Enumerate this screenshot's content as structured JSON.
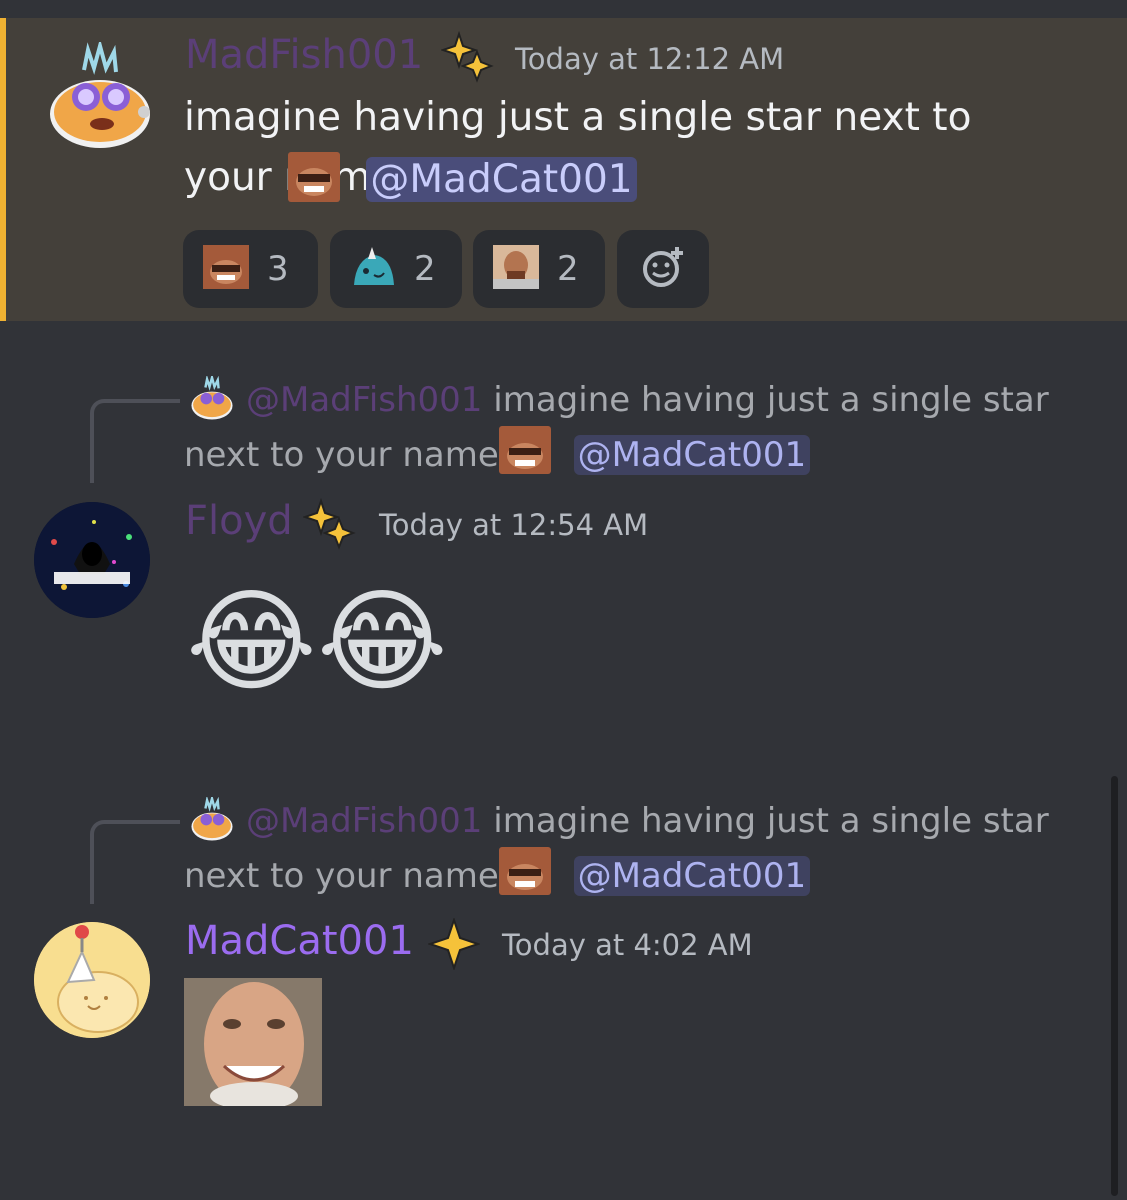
{
  "messages": [
    {
      "username": "MadFish001",
      "timestamp": "Today at 12:12 AM",
      "text": "imagine having just a single star next to your name",
      "mention": "@MadCat001",
      "reactions": [
        {
          "emoji": "laughing-man-emoji",
          "count": "3"
        },
        {
          "emoji": "teal-creature-emoji",
          "count": "2"
        },
        {
          "emoji": "thinking-man-emoji",
          "count": "2"
        }
      ]
    },
    {
      "reply": {
        "username": "@MadFish001",
        "text_line1": "imagine having just a single star",
        "text_line2": "next to your name",
        "mention": "@MadCat001"
      },
      "username": "Floyd",
      "avatar_label": "ALL IN CRYPTO",
      "timestamp": "Today at 12:54 AM",
      "emojis": [
        "😂",
        "😂"
      ]
    },
    {
      "reply": {
        "username": "@MadFish001",
        "text_line1": "imagine having just a single star",
        "text_line2": "next to your name",
        "mention": "@MadCat001"
      },
      "username": "MadCat001",
      "timestamp": "Today at 4:02 AM",
      "attachment": "smiling-old-man-image"
    }
  ],
  "colors": {
    "background": "#313338",
    "highlight": "#44403a",
    "highlight_bar": "#f0b232",
    "username_dim": "#5b3f78",
    "username_madcat": "#9b6cf0",
    "mention_bg": "#4a4d7a"
  }
}
